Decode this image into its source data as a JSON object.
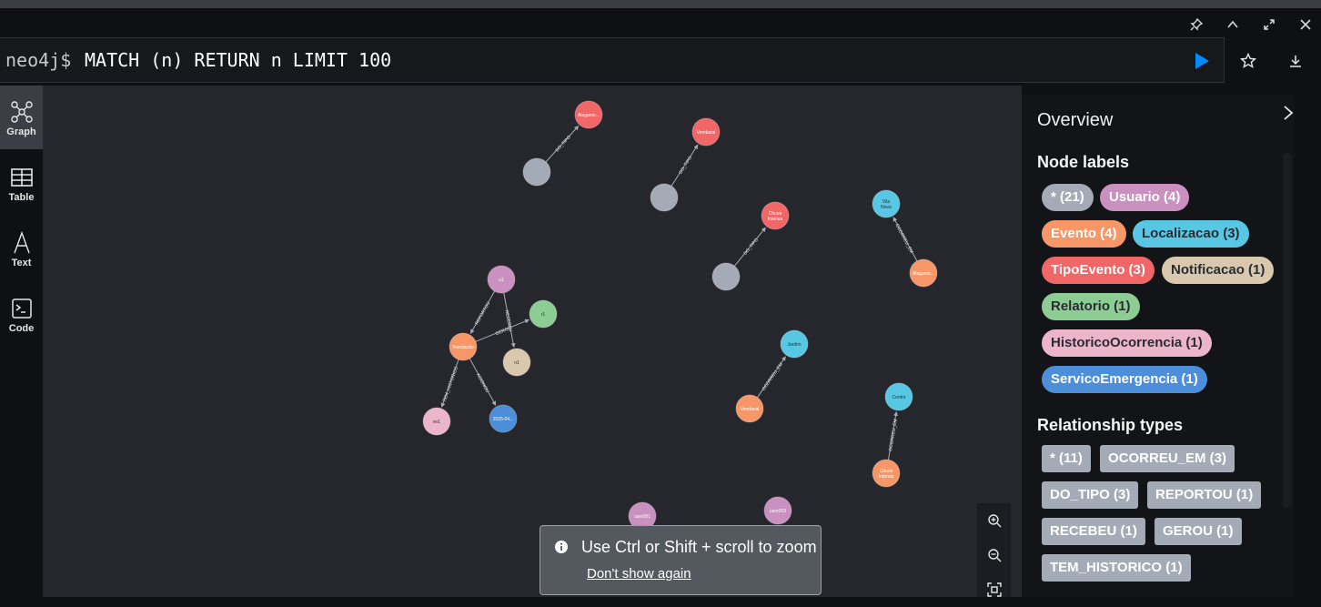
{
  "window_controls": [
    "pin-icon",
    "chevron-up-icon",
    "expand-icon",
    "close-icon"
  ],
  "editor": {
    "prompt": "neo4j$",
    "query": "MATCH (n) RETURN n LIMIT 100",
    "run_icon": "play-icon",
    "favorite_icon": "star-icon",
    "download_icon": "download-icon"
  },
  "sidenav": [
    {
      "label": "Graph",
      "icon": "graph-icon",
      "active": true
    },
    {
      "label": "Table",
      "icon": "table-icon",
      "active": false
    },
    {
      "label": "Text",
      "icon": "text-icon",
      "active": false
    },
    {
      "label": "Code",
      "icon": "code-icon",
      "active": false
    }
  ],
  "graph": {
    "nodes": [
      {
        "id": "n_alag1",
        "label": "Alagame...",
        "color": "#f16667"
      },
      {
        "id": "n_g1",
        "label": "",
        "color": "#a5abb6"
      },
      {
        "id": "n_vend1",
        "label": "Vendaval",
        "color": "#f16667"
      },
      {
        "id": "n_g2",
        "label": "",
        "color": "#a5abb6"
      },
      {
        "id": "n_chuva1",
        "label": "Chuva Intensa",
        "color": "#f16667"
      },
      {
        "id": "n_g3",
        "label": "",
        "color": "#a5abb6"
      },
      {
        "id": "n_vila",
        "label": "Vila Nova",
        "color": "#57c7e3"
      },
      {
        "id": "n_alag2",
        "label": "Alagame...",
        "color": "#f79767"
      },
      {
        "id": "n_u1",
        "label": "u1",
        "color": "#c990c0"
      },
      {
        "id": "n_r1",
        "label": "r1",
        "color": "#8dcc93"
      },
      {
        "id": "n_inund",
        "label": "Inundacão",
        "color": "#f79767"
      },
      {
        "id": "n_n1",
        "label": "n1",
        "color": "#d9c8ae"
      },
      {
        "id": "n_ev1",
        "label": "ev1",
        "color": "#ecb5c9"
      },
      {
        "id": "n_2025",
        "label": "2025-04...",
        "color": "#4c8eda"
      },
      {
        "id": "n_jardim",
        "label": "Jardim",
        "color": "#57c7e3"
      },
      {
        "id": "n_vend2",
        "label": "Vendaval",
        "color": "#f79767"
      },
      {
        "id": "n_centro",
        "label": "Centro",
        "color": "#57c7e3"
      },
      {
        "id": "n_chuva2",
        "label": "Chuva Intensa",
        "color": "#f79767"
      },
      {
        "id": "n_user001",
        "label": "user001",
        "color": "#c990c0"
      },
      {
        "id": "n_user003",
        "label": "user003",
        "color": "#c990c0"
      }
    ],
    "relationships": [
      {
        "type": "DO_TIPO"
      },
      {
        "type": "DO_TIPO"
      },
      {
        "type": "DO_TIPO"
      },
      {
        "type": "OCORREU_EM"
      },
      {
        "type": "REPORTOU"
      },
      {
        "type": "RECEBEU"
      },
      {
        "type": "GEROU"
      },
      {
        "type": "TEM_HISTORICO"
      },
      {
        "type": "ACIONOU"
      },
      {
        "type": "OCORREU_EM"
      },
      {
        "type": "OCORREU_EM"
      }
    ]
  },
  "overview": {
    "title": "Overview",
    "node_labels_heading": "Node labels",
    "node_labels": [
      {
        "text": "* (21)",
        "color": "#a5abb6",
        "fg": "#ffffff"
      },
      {
        "text": "Usuario (4)",
        "color": "#c990c0",
        "fg": "#ffffff"
      },
      {
        "text": "Evento (4)",
        "color": "#f79767",
        "fg": "#ffffff"
      },
      {
        "text": "Localizacao (3)",
        "color": "#57c7e3",
        "fg": "#2a2c34"
      },
      {
        "text": "TipoEvento (3)",
        "color": "#f16667",
        "fg": "#ffffff"
      },
      {
        "text": "Notificacao (1)",
        "color": "#d9c8ae",
        "fg": "#2a2c34"
      },
      {
        "text": "Relatorio (1)",
        "color": "#8dcc93",
        "fg": "#2a2c34"
      },
      {
        "text": "HistoricoOcorrencia (1)",
        "color": "#ecb5c9",
        "fg": "#2a2c34"
      },
      {
        "text": "ServicoEmergencia (1)",
        "color": "#4c8eda",
        "fg": "#ffffff"
      }
    ],
    "rel_types_heading": "Relationship types",
    "rel_types": [
      "* (11)",
      "OCORREU_EM (3)",
      "DO_TIPO (3)",
      "REPORTOU (1)",
      "RECEBEU (1)",
      "GEROU (1)",
      "TEM_HISTORICO (1)"
    ]
  },
  "zoom": [
    "zoom-in-icon",
    "zoom-out-icon",
    "fit-icon"
  ],
  "toast": {
    "message": "Use Ctrl or Shift + scroll to zoom",
    "dismiss": "Don't show again"
  }
}
